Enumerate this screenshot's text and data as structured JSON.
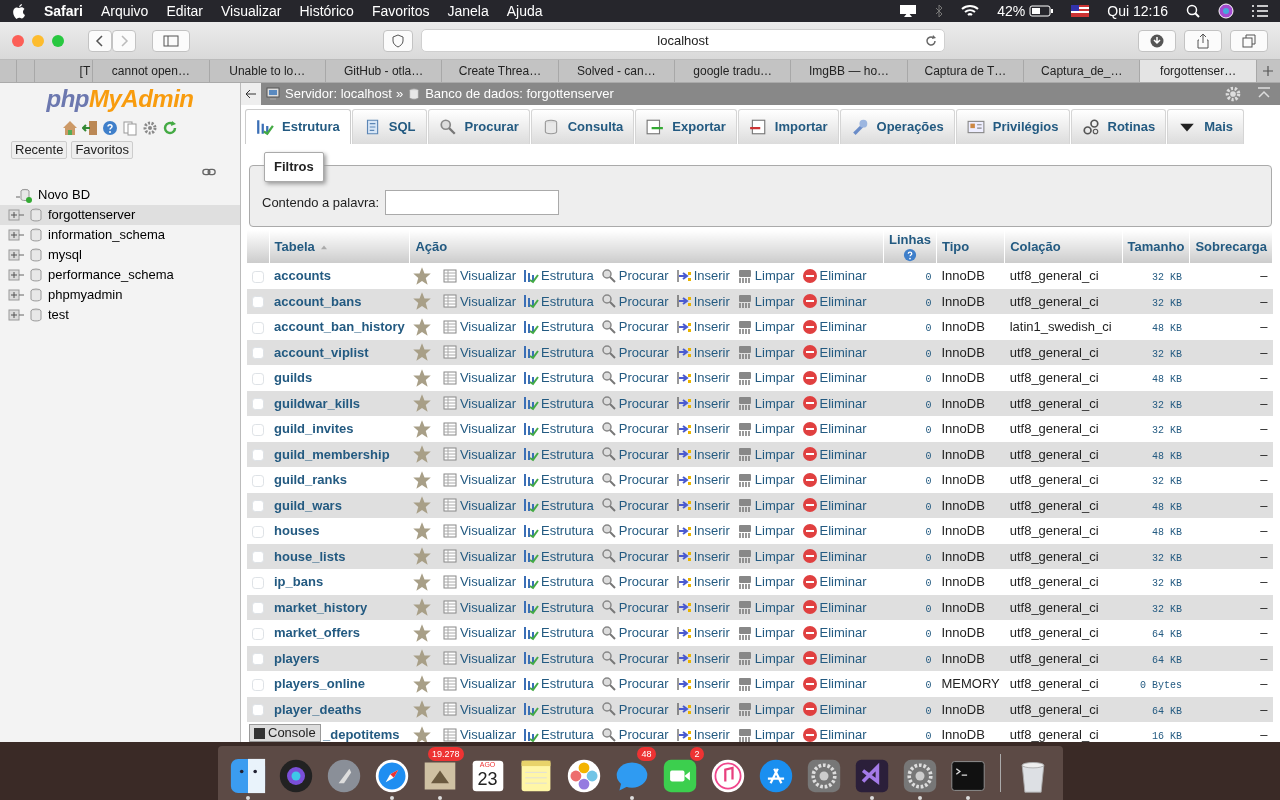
{
  "menubar": {
    "app": "Safari",
    "menus": [
      "Arquivo",
      "Editar",
      "Visualizar",
      "Histórico",
      "Favoritos",
      "Janela",
      "Ajuda"
    ],
    "battery": "42%",
    "clock": "Qui 12:16"
  },
  "browser": {
    "address": "localhost",
    "tabs": [
      {
        "label": "[T",
        "selected": false
      },
      {
        "label": "cannot open…",
        "selected": false
      },
      {
        "label": "Unable to lo…",
        "selected": false
      },
      {
        "label": "GitHub - otla…",
        "selected": false
      },
      {
        "label": "Create Threa…",
        "selected": false
      },
      {
        "label": "Solved - can…",
        "selected": false
      },
      {
        "label": "google tradu…",
        "selected": false
      },
      {
        "label": "ImgBB — ho…",
        "selected": false
      },
      {
        "label": "Captura de T…",
        "selected": false
      },
      {
        "label": "Captura_de_…",
        "selected": false
      },
      {
        "label": "forgottenser…",
        "selected": true
      }
    ]
  },
  "sidebar": {
    "logo": {
      "first": "php",
      "second": "MyAdmin"
    },
    "buttons": [
      "Recente",
      "Favoritos"
    ],
    "new_db": "Novo BD",
    "databases": [
      {
        "name": "forgottenserver",
        "selected": true
      },
      {
        "name": "information_schema",
        "selected": false
      },
      {
        "name": "mysql",
        "selected": false
      },
      {
        "name": "performance_schema",
        "selected": false
      },
      {
        "name": "phpmyadmin",
        "selected": false
      },
      {
        "name": "test",
        "selected": false
      }
    ]
  },
  "breadcrumb": {
    "items": [
      "Servidor: localhost",
      "Banco de dados: forgottenserver"
    ],
    "separator": "»"
  },
  "tabs": [
    {
      "label": "Estrutura",
      "kind": "structure",
      "selected": true
    },
    {
      "label": "SQL",
      "kind": "sql",
      "selected": false
    },
    {
      "label": "Procurar",
      "kind": "search",
      "selected": false
    },
    {
      "label": "Consulta",
      "kind": "query",
      "selected": false
    },
    {
      "label": "Exportar",
      "kind": "export",
      "selected": false
    },
    {
      "label": "Importar",
      "kind": "import",
      "selected": false
    },
    {
      "label": "Operações",
      "kind": "operations",
      "selected": false
    },
    {
      "label": "Privilégios",
      "kind": "privileges",
      "selected": false
    },
    {
      "label": "Rotinas",
      "kind": "routines",
      "selected": false
    },
    {
      "label": "Mais",
      "kind": "more",
      "selected": false
    }
  ],
  "filter": {
    "legend": "Filtros",
    "label": "Contendo a palavra:"
  },
  "table": {
    "columns": [
      "Tabela",
      "Ação",
      "Linhas",
      "Tipo",
      "Colação",
      "Tamanho",
      "Sobrecarga"
    ],
    "rows": [
      {
        "name": "accounts",
        "covered": false,
        "actions": [
          "Visualizar",
          "Estrutura",
          "Procurar",
          "Inserir",
          "Limpar",
          "Eliminar"
        ],
        "rows": "0",
        "engine": "InnoDB",
        "collation": "utf8_general_ci",
        "size": "32 KB",
        "overhead": "–"
      },
      {
        "name": "account_bans",
        "covered": false,
        "actions": [
          "Visualizar",
          "Estrutura",
          "Procurar",
          "Inserir",
          "Limpar",
          "Eliminar"
        ],
        "rows": "0",
        "engine": "InnoDB",
        "collation": "utf8_general_ci",
        "size": "32 KB",
        "overhead": "–"
      },
      {
        "name": "account_ban_history",
        "covered": false,
        "actions": [
          "Visualizar",
          "Estrutura",
          "Procurar",
          "Inserir",
          "Limpar",
          "Eliminar"
        ],
        "rows": "0",
        "engine": "InnoDB",
        "collation": "latin1_swedish_ci",
        "size": "48 KB",
        "overhead": "–"
      },
      {
        "name": "account_viplist",
        "covered": false,
        "actions": [
          "Visualizar",
          "Estrutura",
          "Procurar",
          "Inserir",
          "Limpar",
          "Eliminar"
        ],
        "rows": "0",
        "engine": "InnoDB",
        "collation": "utf8_general_ci",
        "size": "32 KB",
        "overhead": "–"
      },
      {
        "name": "guilds",
        "covered": false,
        "actions": [
          "Visualizar",
          "Estrutura",
          "Procurar",
          "Inserir",
          "Limpar",
          "Eliminar"
        ],
        "rows": "0",
        "engine": "InnoDB",
        "collation": "utf8_general_ci",
        "size": "48 KB",
        "overhead": "–"
      },
      {
        "name": "guildwar_kills",
        "covered": false,
        "actions": [
          "Visualizar",
          "Estrutura",
          "Procurar",
          "Inserir",
          "Limpar",
          "Eliminar"
        ],
        "rows": "0",
        "engine": "InnoDB",
        "collation": "utf8_general_ci",
        "size": "32 KB",
        "overhead": "–"
      },
      {
        "name": "guild_invites",
        "covered": false,
        "actions": [
          "Visualizar",
          "Estrutura",
          "Procurar",
          "Inserir",
          "Limpar",
          "Eliminar"
        ],
        "rows": "0",
        "engine": "InnoDB",
        "collation": "utf8_general_ci",
        "size": "32 KB",
        "overhead": "–"
      },
      {
        "name": "guild_membership",
        "covered": false,
        "actions": [
          "Visualizar",
          "Estrutura",
          "Procurar",
          "Inserir",
          "Limpar",
          "Eliminar"
        ],
        "rows": "0",
        "engine": "InnoDB",
        "collation": "utf8_general_ci",
        "size": "48 KB",
        "overhead": "–"
      },
      {
        "name": "guild_ranks",
        "covered": false,
        "actions": [
          "Visualizar",
          "Estrutura",
          "Procurar",
          "Inserir",
          "Limpar",
          "Eliminar"
        ],
        "rows": "0",
        "engine": "InnoDB",
        "collation": "utf8_general_ci",
        "size": "32 KB",
        "overhead": "–"
      },
      {
        "name": "guild_wars",
        "covered": false,
        "actions": [
          "Visualizar",
          "Estrutura",
          "Procurar",
          "Inserir",
          "Limpar",
          "Eliminar"
        ],
        "rows": "0",
        "engine": "InnoDB",
        "collation": "utf8_general_ci",
        "size": "48 KB",
        "overhead": "–"
      },
      {
        "name": "houses",
        "covered": false,
        "actions": [
          "Visualizar",
          "Estrutura",
          "Procurar",
          "Inserir",
          "Limpar",
          "Eliminar"
        ],
        "rows": "0",
        "engine": "InnoDB",
        "collation": "utf8_general_ci",
        "size": "48 KB",
        "overhead": "–"
      },
      {
        "name": "house_lists",
        "covered": false,
        "actions": [
          "Visualizar",
          "Estrutura",
          "Procurar",
          "Inserir",
          "Limpar",
          "Eliminar"
        ],
        "rows": "0",
        "engine": "InnoDB",
        "collation": "utf8_general_ci",
        "size": "32 KB",
        "overhead": "–"
      },
      {
        "name": "ip_bans",
        "covered": false,
        "actions": [
          "Visualizar",
          "Estrutura",
          "Procurar",
          "Inserir",
          "Limpar",
          "Eliminar"
        ],
        "rows": "0",
        "engine": "InnoDB",
        "collation": "utf8_general_ci",
        "size": "32 KB",
        "overhead": "–"
      },
      {
        "name": "market_history",
        "covered": false,
        "actions": [
          "Visualizar",
          "Estrutura",
          "Procurar",
          "Inserir",
          "Limpar",
          "Eliminar"
        ],
        "rows": "0",
        "engine": "InnoDB",
        "collation": "utf8_general_ci",
        "size": "32 KB",
        "overhead": "–"
      },
      {
        "name": "market_offers",
        "covered": false,
        "actions": [
          "Visualizar",
          "Estrutura",
          "Procurar",
          "Inserir",
          "Limpar",
          "Eliminar"
        ],
        "rows": "0",
        "engine": "InnoDB",
        "collation": "utf8_general_ci",
        "size": "64 KB",
        "overhead": "–"
      },
      {
        "name": "players",
        "covered": false,
        "actions": [
          "Visualizar",
          "Estrutura",
          "Procurar",
          "Inserir",
          "Limpar",
          "Eliminar"
        ],
        "rows": "0",
        "engine": "InnoDB",
        "collation": "utf8_general_ci",
        "size": "64 KB",
        "overhead": "–"
      },
      {
        "name": "players_online",
        "covered": false,
        "actions": [
          "Visualizar",
          "Estrutura",
          "Procurar",
          "Inserir",
          "Limpar",
          "Eliminar"
        ],
        "rows": "0",
        "engine": "MEMORY",
        "collation": "utf8_general_ci",
        "size": "0 Bytes",
        "overhead": "–"
      },
      {
        "name": "player_deaths",
        "covered": false,
        "actions": [
          "Visualizar",
          "Estrutura",
          "Procurar",
          "Inserir",
          "Limpar",
          "Eliminar"
        ],
        "rows": "0",
        "engine": "InnoDB",
        "collation": "utf8_general_ci",
        "size": "64 KB",
        "overhead": "–"
      },
      {
        "name": "_depotitems",
        "covered": true,
        "actions": [
          "Visualizar",
          "Estrutura",
          "Procurar",
          "Inserir",
          "Limpar",
          "Eliminar"
        ],
        "rows": "0",
        "engine": "InnoDB",
        "collation": "utf8_general_ci",
        "size": "16 KB",
        "overhead": "–"
      }
    ]
  },
  "console": {
    "label": "Console"
  },
  "dock": [
    {
      "kind": "finder",
      "running": true
    },
    {
      "kind": "siri",
      "running": false
    },
    {
      "kind": "launchpad",
      "running": false
    },
    {
      "kind": "safari",
      "running": true
    },
    {
      "kind": "mail",
      "running": true,
      "badge": "19.278"
    },
    {
      "kind": "calendar",
      "running": false,
      "month": "AGO",
      "day": "23"
    },
    {
      "kind": "notes",
      "running": false
    },
    {
      "kind": "photos",
      "running": false
    },
    {
      "kind": "messages",
      "running": true,
      "badge": "48"
    },
    {
      "kind": "facetime",
      "running": false,
      "badge": "2"
    },
    {
      "kind": "music",
      "running": false
    },
    {
      "kind": "appstore",
      "running": false
    },
    {
      "kind": "settings",
      "running": false
    },
    {
      "kind": "studio",
      "running": true
    },
    {
      "kind": "settings",
      "running": true
    },
    {
      "kind": "terminal",
      "running": true
    },
    {
      "kind": "trash",
      "running": false
    }
  ]
}
